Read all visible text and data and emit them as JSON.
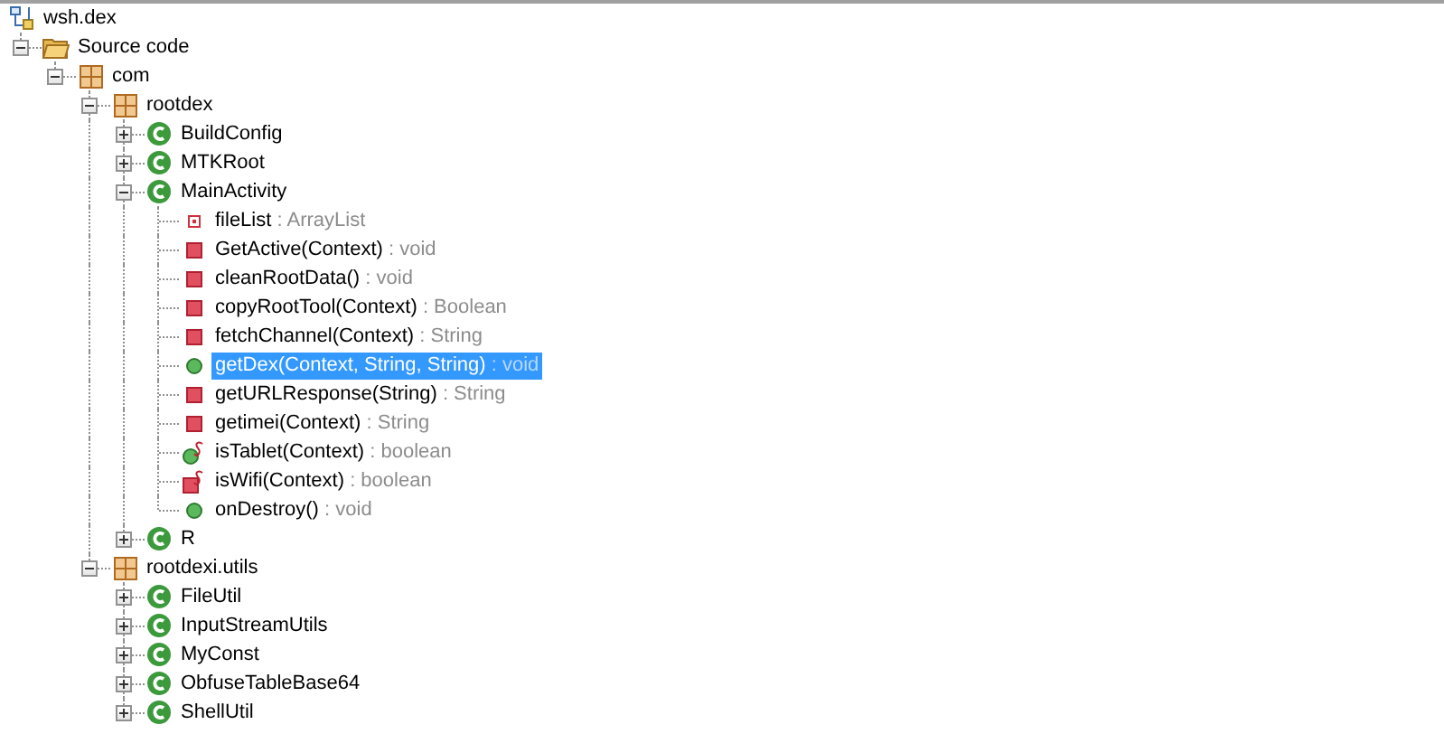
{
  "tree": [
    {
      "kind": "project",
      "label": "wsh.dex",
      "selected": false,
      "children": [
        {
          "kind": "folder",
          "label": "Source code",
          "expanded": true,
          "selected": false,
          "children": [
            {
              "kind": "package",
              "label": "com",
              "expanded": true,
              "selected": false,
              "children": [
                {
                  "kind": "package",
                  "label": "rootdex",
                  "expanded": true,
                  "selected": false,
                  "children": [
                    {
                      "kind": "class",
                      "label": "BuildConfig",
                      "expanded": false,
                      "selected": false
                    },
                    {
                      "kind": "class",
                      "label": "MTKRoot",
                      "expanded": false,
                      "selected": false
                    },
                    {
                      "kind": "class",
                      "label": "MainActivity",
                      "expanded": true,
                      "selected": false,
                      "children": [
                        {
                          "kind": "field",
                          "label": "fileList",
                          "type": ": ArrayList",
                          "selected": false
                        },
                        {
                          "kind": "private-method",
                          "label": "GetActive(Context)",
                          "type": ": void",
                          "selected": false
                        },
                        {
                          "kind": "private-method",
                          "label": "cleanRootData()",
                          "type": ": void",
                          "selected": false
                        },
                        {
                          "kind": "private-method",
                          "label": "copyRootTool(Context)",
                          "type": ": Boolean",
                          "selected": false
                        },
                        {
                          "kind": "private-method",
                          "label": "fetchChannel(Context)",
                          "type": ": String",
                          "selected": false
                        },
                        {
                          "kind": "public-method",
                          "label": "getDex(Context, String, String)",
                          "type": ": void",
                          "selected": true
                        },
                        {
                          "kind": "private-method",
                          "label": "getURLResponse(String)",
                          "type": ": String",
                          "selected": false
                        },
                        {
                          "kind": "private-method",
                          "label": "getimei(Context)",
                          "type": ": String",
                          "selected": false
                        },
                        {
                          "kind": "public-static-method",
                          "label": "isTablet(Context)",
                          "type": ": boolean",
                          "selected": false
                        },
                        {
                          "kind": "private-static-method",
                          "label": "isWifi(Context)",
                          "type": ": boolean",
                          "selected": false
                        },
                        {
                          "kind": "public-method",
                          "label": "onDestroy()",
                          "type": ": void",
                          "selected": false
                        }
                      ]
                    },
                    {
                      "kind": "class",
                      "label": "R",
                      "expanded": false,
                      "selected": false
                    }
                  ]
                },
                {
                  "kind": "package",
                  "label": "rootdexi.utils",
                  "expanded": true,
                  "selected": false,
                  "children": [
                    {
                      "kind": "class",
                      "label": "FileUtil",
                      "expanded": false,
                      "selected": false
                    },
                    {
                      "kind": "class",
                      "label": "InputStreamUtils",
                      "expanded": false,
                      "selected": false
                    },
                    {
                      "kind": "class",
                      "label": "MyConst",
                      "expanded": false,
                      "selected": false
                    },
                    {
                      "kind": "class",
                      "label": "ObfuseTableBase64",
                      "expanded": false,
                      "selected": false
                    },
                    {
                      "kind": "class",
                      "label": "ShellUtil",
                      "expanded": false,
                      "selected": false
                    }
                  ]
                }
              ]
            }
          ]
        }
      ]
    }
  ]
}
